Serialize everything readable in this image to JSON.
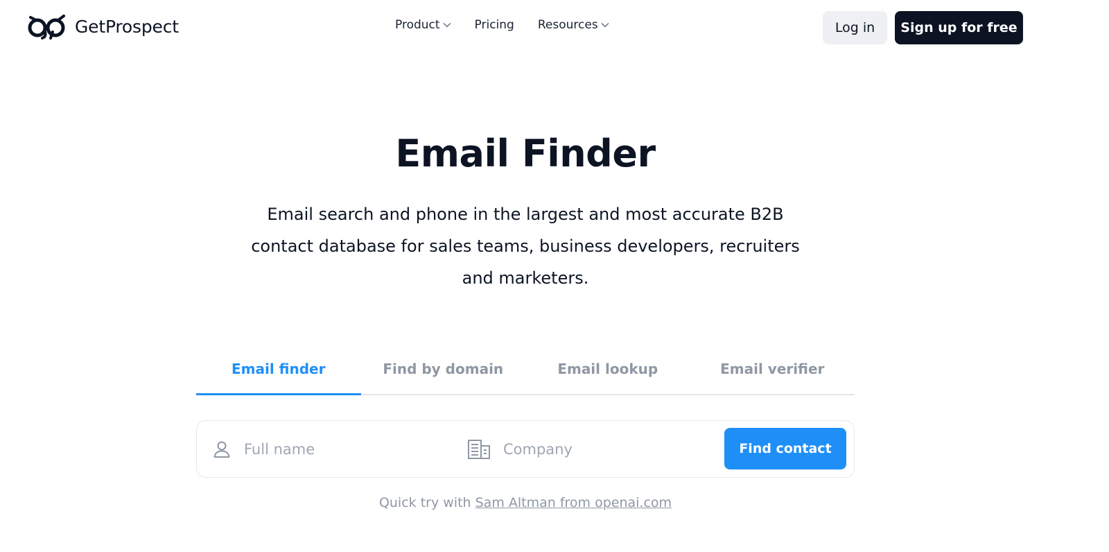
{
  "header": {
    "logo_text": "GetProspect",
    "nav": [
      {
        "label": "Product",
        "has_dropdown": true
      },
      {
        "label": "Pricing",
        "has_dropdown": false
      },
      {
        "label": "Resources",
        "has_dropdown": true
      }
    ],
    "login_label": "Log in",
    "signup_label": "Sign up for free"
  },
  "hero": {
    "title": "Email Finder",
    "subtitle": "Email search and phone in the largest and most accurate B2B contact database for sales teams, business developers, recruiters and marketers."
  },
  "tabs": [
    {
      "label": "Email finder",
      "active": true
    },
    {
      "label": "Find by domain",
      "active": false
    },
    {
      "label": "Email lookup",
      "active": false
    },
    {
      "label": "Email verifier",
      "active": false
    }
  ],
  "search": {
    "name_placeholder": "Full name",
    "company_placeholder": "Company",
    "name_value": "",
    "company_value": "",
    "button_label": "Find contact"
  },
  "quick_try": {
    "prefix": "Quick try with",
    "link_text": "Sam Altman from openai.com"
  },
  "colors": {
    "accent": "#1f8ff8",
    "dark": "#0c1423",
    "muted": "#8f97a3"
  }
}
